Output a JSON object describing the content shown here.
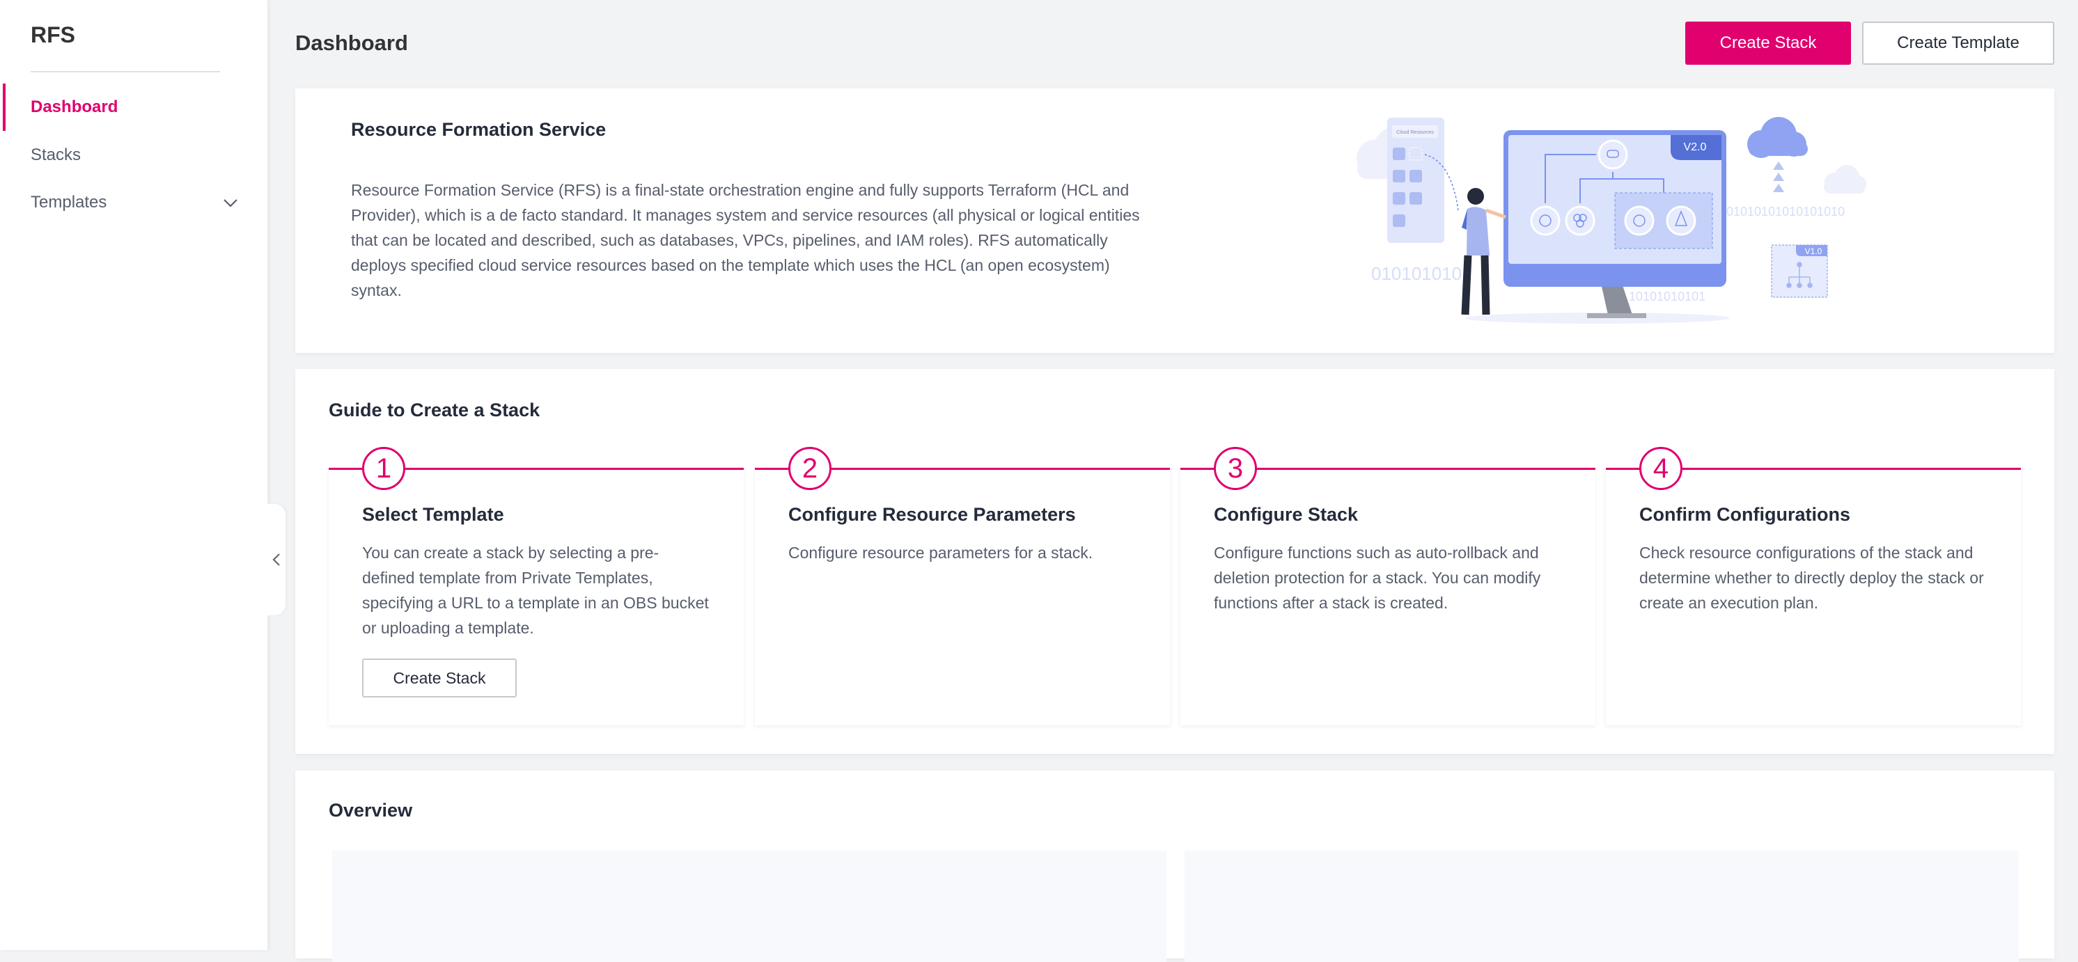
{
  "sidebar": {
    "brand": "RFS",
    "items": [
      {
        "label": "Dashboard",
        "active": true
      },
      {
        "label": "Stacks",
        "active": false
      },
      {
        "label": "Templates",
        "active": false,
        "expandable": true
      }
    ],
    "collapse_icon": "chevron-left-icon"
  },
  "header": {
    "title": "Dashboard",
    "create_stack_label": "Create Stack",
    "create_template_label": "Create Template"
  },
  "intro": {
    "title": "Resource Formation Service",
    "description": "Resource Formation Service (RFS) is a final-state orchestration engine and fully supports Terraform (HCL and Provider), which is a de facto standard. It manages system and service resources (all physical or logical entities that can be located and described, such as databases, VPCs, pipelines, and IAM roles). RFS automatically deploys specified cloud service resources based on the template which uses the HCL (an open ecosystem) syntax.",
    "illustration": {
      "panel_label": "Cloud Resources",
      "version_new": "V2.0",
      "version_old": "V1.0",
      "binary_1": "0101010101",
      "binary_2": "01010101010101010",
      "binary_3": "10101010101"
    }
  },
  "guide": {
    "title": "Guide to Create a Stack",
    "steps": [
      {
        "number": "1",
        "title": "Select Template",
        "description": "You can create a stack by selecting a pre-defined template from Private Templates, specifying a URL to a template in an OBS bucket or uploading a template.",
        "button": "Create Stack"
      },
      {
        "number": "2",
        "title": "Configure Resource Parameters",
        "description": "Configure resource parameters for a stack."
      },
      {
        "number": "3",
        "title": "Configure Stack",
        "description": "Configure functions such as auto-rollback and deletion protection for a stack. You can modify functions after a stack is created."
      },
      {
        "number": "4",
        "title": "Confirm Configurations",
        "description": "Check resource configurations of the stack and determine whether to directly deploy the stack or create an execution plan."
      }
    ]
  },
  "overview": {
    "title": "Overview"
  },
  "colors": {
    "accent": "#e0006e",
    "background": "#f2f3f5",
    "illustration_blue": "#7b93ee"
  }
}
